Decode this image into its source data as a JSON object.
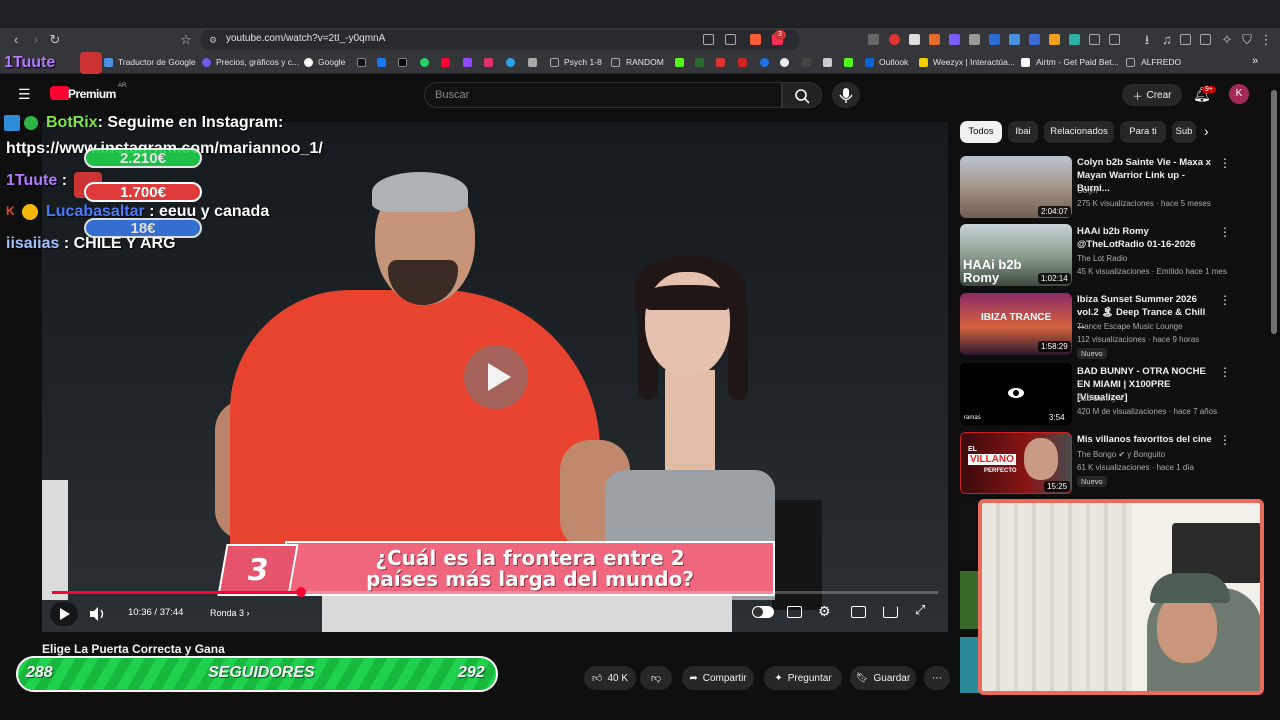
{
  "browser": {
    "url": "youtube.com/watch?v=2tI_-y0qmnA",
    "bookmarks": [
      "Traductor de Google",
      "Precios, gráficos y c...",
      "Google",
      "Psych 1-8",
      "RANDOM",
      "Outlook",
      "Weezyx | Interactúa...",
      "Airtm - Get Paid Bet...",
      "ALFREDO"
    ],
    "ext_badge": "3"
  },
  "yt": {
    "logo_text": "Premium",
    "region": "AR",
    "search_placeholder": "Buscar",
    "create_label": "Crear",
    "notif_count": "9+",
    "avatar_letter": "K"
  },
  "video": {
    "question_number": "3",
    "question_line1": "¿Cuál es la frontera entre 2",
    "question_line2": "países más larga del mundo?",
    "time": "10:36 / 37:44",
    "chapter": "Ronda 3",
    "progress": 0.281,
    "title": "Elige La Puerta Correcta y Gana"
  },
  "overlay": {
    "chat": [
      {
        "user": "BotRix",
        "msg": ": Seguime en Instagram:",
        "color": "#7ee84a"
      },
      {
        "user": "",
        "msg": "https://www.instagram.com/mariannoo_1/",
        "color": "#ffffff"
      },
      {
        "user": "1Tuute",
        "msg": ":",
        "color": "#b477ff"
      },
      {
        "user": "Lucabasaltar",
        "msg": ": eeuu y canada",
        "color": "#4a7cff"
      },
      {
        "user": "iisaiias",
        "msg": ": CHILE Y ARG",
        "color": "#9ec3ff"
      }
    ],
    "donations": [
      "1.700€",
      "18€"
    ],
    "donation_top_partial": "2.210€",
    "streamer_name": "1Tuute",
    "followers_current": "288",
    "followers_label": "SEGUIDORES",
    "followers_goal": "292"
  },
  "actions": {
    "likes": "40 K",
    "share": "Compartir",
    "ask": "Preguntar",
    "save": "Guardar"
  },
  "chips": [
    "Todos",
    "Ibai",
    "Relacionados",
    "Para ti",
    "Sub"
  ],
  "recommendations": [
    {
      "title": "Colyn b2b Sainte Vie - Maxa x Mayan Warrior Link up - Burni...",
      "channel": "Colyn",
      "meta": "275 K visualizaciones · hace 5 meses",
      "duration": "2:04:07",
      "badge": ""
    },
    {
      "title": "HAAi b2b Romy @TheLotRadio 01-16-2026",
      "channel": "The Lot Radio",
      "meta": "45 K visualizaciones · Emitido hace 1 mes",
      "duration": "1:02:14",
      "badge": ""
    },
    {
      "title": "Ibiza Sunset Summer 2026 vol.2 🏝 Deep Trance & Chill ...",
      "channel": "Trance Escape Music Lounge",
      "meta": "112 visualizaciones · hace 9 horas",
      "duration": "1:58:29",
      "badge": "Nuevo"
    },
    {
      "title": "BAD BUNNY - OTRA NOCHE EN MIAMI | X100PRE [Visualizer]",
      "channel": "Bad Bunny ✔",
      "meta": "420 M de visualizaciones · hace 7 años",
      "duration": "3:54",
      "badge": ""
    },
    {
      "title": "Mis villanos favoritos del cine",
      "channel": "The Bongo ✔ y Bonguito",
      "meta": "61 K visualizaciones · hace 1 día",
      "duration": "15:25",
      "badge": "Nuevo"
    }
  ],
  "thumb_texts": {
    "t2": "HAAi b2b Romy",
    "t3": "IBIZA TRANCE",
    "t4": "ramas",
    "t5a": "EL",
    "t5b": "VILLANO",
    "t5c": "PERFECTO"
  },
  "colors": {
    "accent_red": "#ff0033",
    "progress_green": "#1fd14c",
    "question_pink": "#f0677d",
    "webcam_border": "#ea6a5c"
  }
}
